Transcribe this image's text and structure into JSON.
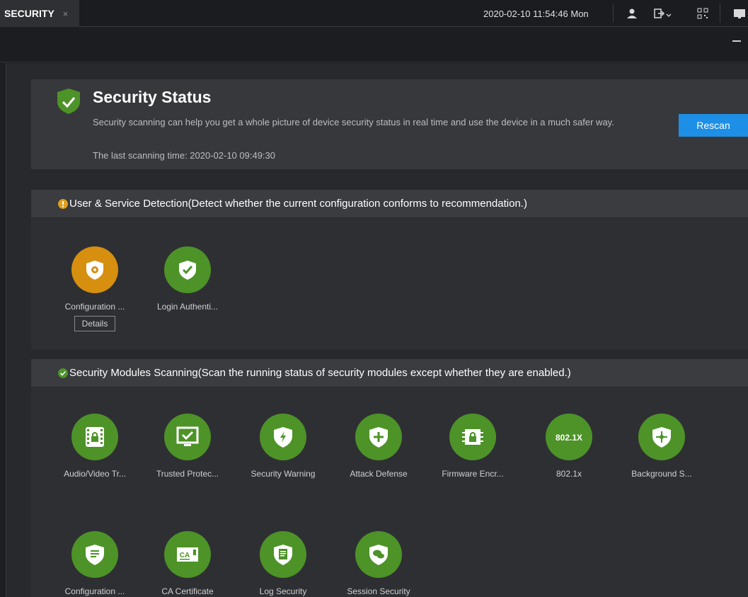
{
  "tab": {
    "label": "SECURITY",
    "close": "×"
  },
  "topbar": {
    "datetime": "2020-02-10 11:54:46 Mon"
  },
  "status": {
    "title": "Security Status",
    "description": "Security scanning can help you get a whole picture of device security status in real time and use the device in a much safer way.",
    "last_scan": "The last scanning time: 2020-02-10 09:49:30",
    "rescan_label": "Rescan"
  },
  "user_service": {
    "header": "User & Service Detection(Detect whether the current configuration conforms to recommendation.)",
    "items": [
      {
        "label": "Configuration ...",
        "icon": "config-shield-icon",
        "state": "warning",
        "details": "Details"
      },
      {
        "label": "Login Authenti...",
        "icon": "check-shield-icon",
        "state": "ok"
      }
    ]
  },
  "modules": {
    "header": "Security Modules Scanning(Scan the running status of security modules except whether they are enabled.)",
    "items": [
      {
        "label": "Audio/Video Tr...",
        "icon": "av-lock-icon"
      },
      {
        "label": "Trusted Protec...",
        "icon": "monitor-check-icon"
      },
      {
        "label": "Security Warning",
        "icon": "lightning-shield-icon"
      },
      {
        "label": "Attack Defense",
        "icon": "plus-shield-icon"
      },
      {
        "label": "Firmware Encr...",
        "icon": "chip-lock-icon"
      },
      {
        "label": "802.1x",
        "icon": "8021x-icon",
        "badge": "802.1X"
      },
      {
        "label": "Background S...",
        "icon": "cross-shield-icon"
      },
      {
        "label": "Configuration ...",
        "icon": "doc-shield-icon"
      },
      {
        "label": "CA Certificate",
        "icon": "ca-cert-icon",
        "badge": "CA"
      },
      {
        "label": "Log Security",
        "icon": "log-shield-icon"
      },
      {
        "label": "Session Security",
        "icon": "chat-shield-icon"
      }
    ]
  },
  "colors": {
    "ok": "#4d9328",
    "warning": "#d68f0f",
    "accent": "#1e8fe6"
  }
}
